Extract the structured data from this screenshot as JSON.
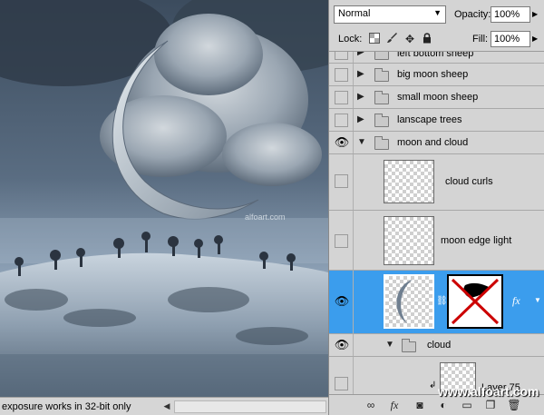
{
  "canvas": {
    "watermark": "alfoart.com"
  },
  "status_bar": {
    "text": "exposure works in 32-bit only"
  },
  "panel": {
    "blend_mode": "Normal",
    "opacity_label": "Opacity:",
    "opacity_value": "100%",
    "lock_label": "Lock:",
    "fill_label": "Fill:",
    "fill_value": "100%"
  },
  "layers": [
    {
      "name": "left bottom sheep",
      "type": "group",
      "visible": false,
      "expanded": false
    },
    {
      "name": "big moon sheep",
      "type": "group",
      "visible": false,
      "expanded": false
    },
    {
      "name": "small moon sheep",
      "type": "group",
      "visible": false,
      "expanded": false
    },
    {
      "name": "lanscape trees",
      "type": "group",
      "visible": false,
      "expanded": false
    },
    {
      "name": "moon and cloud",
      "type": "group",
      "visible": true,
      "expanded": true
    },
    {
      "name": "cloud curls",
      "type": "layer",
      "visible": false
    },
    {
      "name": "moon edge light",
      "type": "layer",
      "visible": false
    },
    {
      "name": "",
      "type": "layer",
      "visible": true,
      "selected": true,
      "has_mask": true,
      "has_fx": true
    },
    {
      "name": "cloud",
      "type": "group",
      "visible": true,
      "expanded": true
    },
    {
      "name": "Layer 75",
      "type": "layer",
      "visible": false
    }
  ],
  "footer": {
    "watermark": "www.alfoart.com",
    "fx_label": "fx"
  },
  "colors": {
    "selection": "#3b9ded",
    "panel_bg": "#d4d4d4"
  }
}
